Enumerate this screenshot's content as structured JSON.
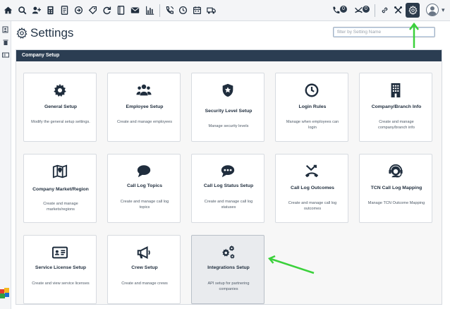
{
  "toolbar": {
    "icons": [
      "home-icon",
      "search-icon",
      "add-person-icon",
      "calculator-icon",
      "invoice-icon",
      "forward-icon",
      "tag-icon",
      "refresh-icon",
      "phone-book-icon",
      "mail-icon",
      "bar-chart-icon",
      "phone-call-icon",
      "clock-icon",
      "calendar-icon",
      "truck-icon"
    ],
    "calls_badge": "0",
    "missed_badge": "0",
    "right_icons": [
      "link-icon",
      "tools-icon",
      "settings-gear-icon",
      "user-avatar-icon"
    ]
  },
  "page": {
    "title": "Settings",
    "filter_placeholder": "filter by Setting Name"
  },
  "panel": {
    "header": "Company Setup",
    "cards": [
      {
        "icon": "gear-icon",
        "title": "General Setup",
        "desc": "Modify the general setup settings."
      },
      {
        "icon": "people-icon",
        "title": "Employee Setup",
        "desc": "Create and manage employees"
      },
      {
        "icon": "shield-icon",
        "title": "Security Level Setup",
        "desc": "Manage security levels"
      },
      {
        "icon": "clock-icon",
        "title": "Login Rules",
        "desc": "Manage when employees can login"
      },
      {
        "icon": "building-icon",
        "title": "Company/Branch Info",
        "desc": "Create and manage company/branch info"
      },
      {
        "icon": "map-icon",
        "title": "Company Market/Region",
        "desc": "Create and manage markets/regions"
      },
      {
        "icon": "speech-bubble-icon",
        "title": "Call Log Topics",
        "desc": "Create and manage call log topics"
      },
      {
        "icon": "dots-bubble-icon",
        "title": "Call Log Status Setup",
        "desc": "Create and manage call log statuses"
      },
      {
        "icon": "call-end-icon",
        "title": "Call Log Outcomes",
        "desc": "Create and manage call log outcomes"
      },
      {
        "icon": "headset-icon",
        "title": "TCN Call Log Mapping",
        "desc": "Manage TCN Outcome Mapping"
      },
      {
        "icon": "id-card-icon",
        "title": "Service License Setup",
        "desc": "Create and view service licenses"
      },
      {
        "icon": "megaphone-icon",
        "title": "Crew Setup",
        "desc": "Create and manage crews"
      },
      {
        "icon": "gears-icon",
        "title": "Integrations Setup",
        "desc": "API setup for partnering companies"
      }
    ]
  },
  "colors": {
    "accent_dark": "#2b3d52",
    "annotation_green": "#3bd13b",
    "selected_card": "#e9ebee"
  }
}
